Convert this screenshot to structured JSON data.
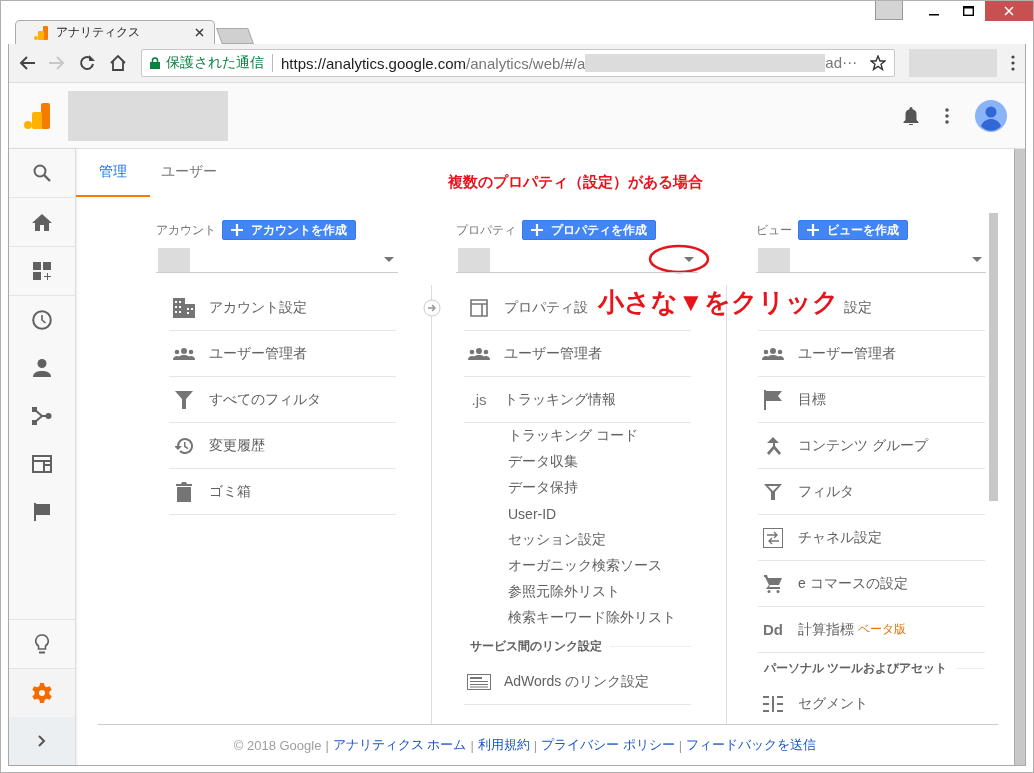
{
  "browser": {
    "tab_title": "アナリティクス",
    "secure_label": "保護された通信",
    "url_host": "https://analytics.google.com",
    "url_path": "/analytics/web/#/a",
    "url_tail": "ad⋯"
  },
  "sidebar": {
    "top": [
      {
        "selected": false
      },
      {
        "selected": false
      },
      {
        "selected": false
      },
      {
        "selected": false
      },
      {
        "selected": false
      },
      {
        "selected": false
      },
      {
        "selected": false
      },
      {
        "selected": false
      }
    ],
    "bottom": [
      {
        "selected": false
      },
      {
        "selected": true
      }
    ]
  },
  "tabs": [
    {
      "label": "管理",
      "selected": true
    },
    {
      "label": "ユーザー",
      "selected": false
    }
  ],
  "annotations": [
    {
      "kind": "title",
      "text": "複数のプロパティ（設定）がある場合"
    },
    {
      "kind": "callout",
      "text": "小さな▼をクリック"
    }
  ],
  "columns": [
    {
      "label": "アカウント",
      "create_button": "アカウントを作成",
      "items": [
        {
          "kind": "item",
          "label": "アカウント設定"
        },
        {
          "kind": "item",
          "label": "ユーザー管理者"
        },
        {
          "kind": "item",
          "label": "すべてのフィルタ"
        },
        {
          "kind": "item",
          "label": "変更履歴"
        },
        {
          "kind": "item",
          "label": "ゴミ箱"
        }
      ]
    },
    {
      "label": "プロパティ",
      "create_button": "プロパティを作成",
      "dropdown": {
        "circled": true
      },
      "items": [
        {
          "kind": "item",
          "label": "プロパティ設"
        },
        {
          "kind": "item",
          "label": "ユーザー管理者"
        },
        {
          "kind": "item",
          "glyph": ".js",
          "label": "トラッキング情報"
        },
        {
          "kind": "subitem",
          "label": "トラッキング コード"
        },
        {
          "kind": "subitem",
          "label": "データ収集"
        },
        {
          "kind": "subitem",
          "label": "データ保持"
        },
        {
          "kind": "subitem",
          "label": "User-ID"
        },
        {
          "kind": "subitem",
          "label": "セッション設定"
        },
        {
          "kind": "subitem",
          "label": "オーガニック検索ソース"
        },
        {
          "kind": "subitem",
          "label": "参照元除外リスト"
        },
        {
          "kind": "subitem",
          "label": "検索キーワード除外リスト"
        },
        {
          "kind": "heading",
          "label": "サービス間のリンク設定"
        },
        {
          "kind": "item",
          "label": "AdWords のリンク設定"
        }
      ]
    },
    {
      "label": "ビュー",
      "create_button": "ビューを作成",
      "items": [
        {
          "kind": "item",
          "label": "設定"
        },
        {
          "kind": "item",
          "label": "ユーザー管理者"
        },
        {
          "kind": "item",
          "label": "目標"
        },
        {
          "kind": "item",
          "label": "コンテンツ グループ"
        },
        {
          "kind": "item",
          "label": "フィルタ"
        },
        {
          "kind": "item",
          "label": "チャネル設定"
        },
        {
          "kind": "item",
          "label": "e コマースの設定"
        },
        {
          "kind": "item",
          "glyph": "Dd",
          "label": "計算指標",
          "badge": "ベータ版"
        },
        {
          "kind": "heading",
          "label": "パーソナル ツールおよびアセット"
        },
        {
          "kind": "item",
          "label": "セグメント"
        }
      ]
    }
  ],
  "footer": [
    {
      "kind": "text",
      "text": "© 2018 Google"
    },
    {
      "kind": "sep",
      "text": "|"
    },
    {
      "kind": "link",
      "text": "アナリティクス ホーム"
    },
    {
      "kind": "sep",
      "text": "|"
    },
    {
      "kind": "link",
      "text": "利用規約"
    },
    {
      "kind": "sep",
      "text": "|"
    },
    {
      "kind": "link",
      "text": "プライバシー ポリシー"
    },
    {
      "kind": "sep",
      "text": "|"
    },
    {
      "kind": "link",
      "text": "フィードバックを送信"
    }
  ]
}
